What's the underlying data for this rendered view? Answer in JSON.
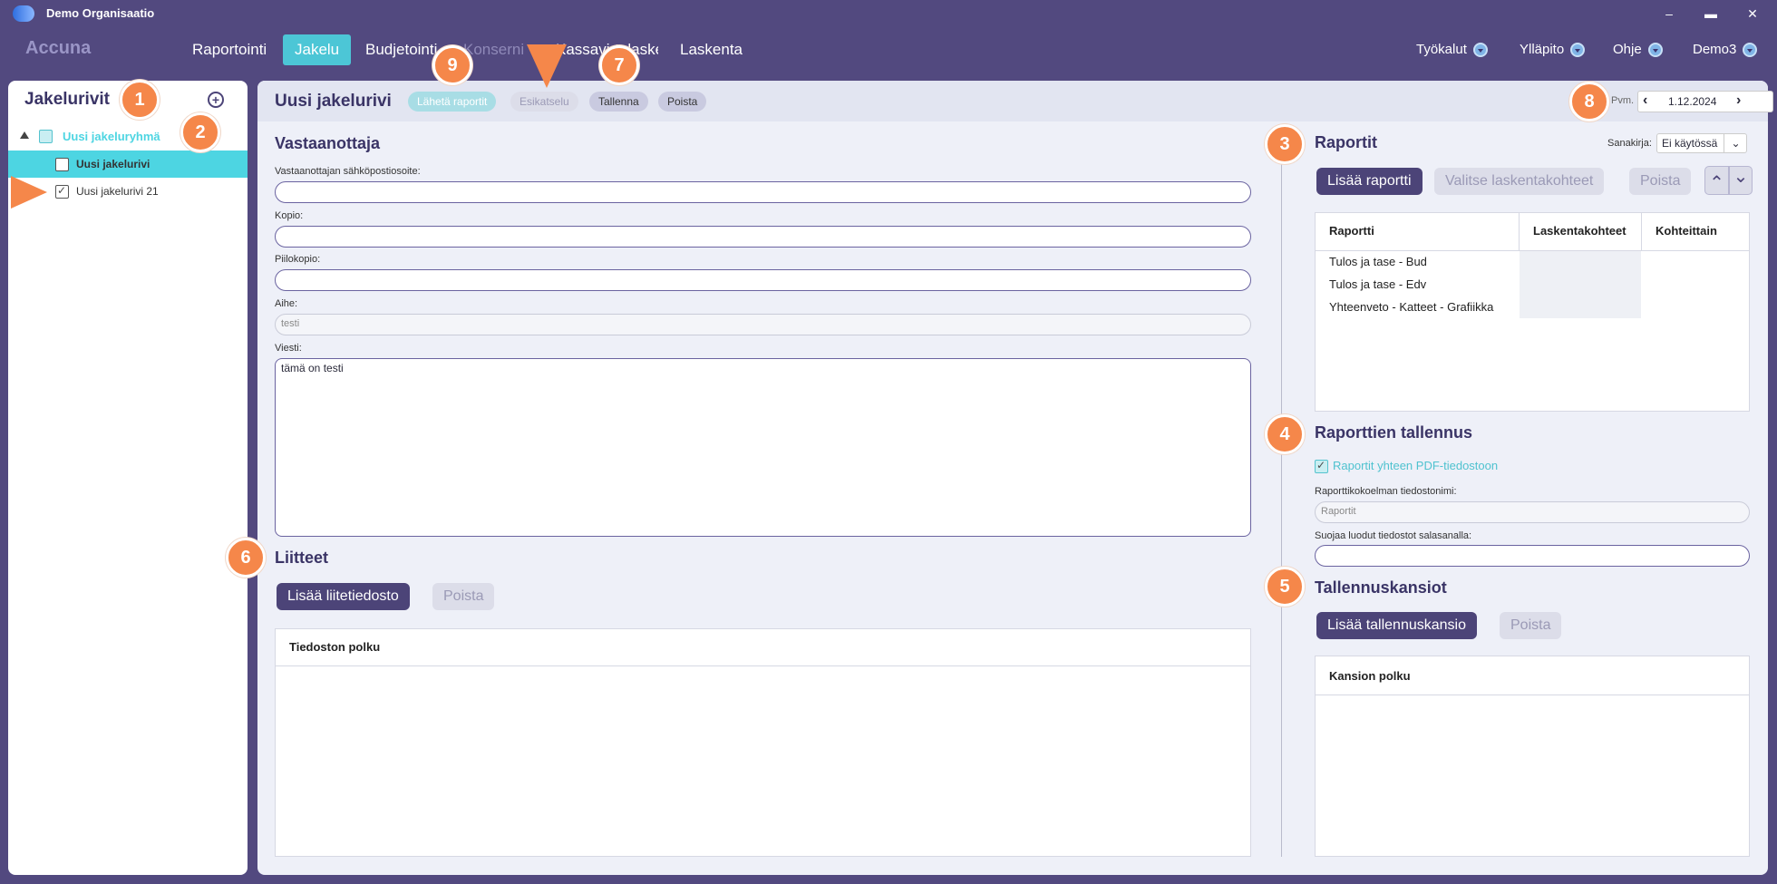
{
  "window": {
    "title": "Demo Organisaatio",
    "minimize": "–",
    "maximize": "▬",
    "close": "✕"
  },
  "nav": {
    "brand": "Accuna",
    "items": [
      "Raportointi",
      "Jakelu",
      "Budjetointi",
      "Konserni",
      "Kassavirtalaskenta",
      "Laskenta"
    ],
    "right": [
      "Työkalut",
      "Ylläpito",
      "Ohje",
      "Demo3"
    ]
  },
  "left": {
    "title": "Jakelurivit",
    "add": "⊕",
    "tree": [
      {
        "label": "Uusi jakeluryhmä",
        "level": 0
      },
      {
        "label": "Uusi jakelurivi",
        "level": 1,
        "selected": true
      },
      {
        "label": "Uusi jakelurivi 21",
        "level": 1,
        "checked": true
      }
    ]
  },
  "main": {
    "title": "Uusi jakelurivi",
    "actions": [
      "Lähetä raportit",
      "Esikatselu",
      "Tallenna",
      "Poista"
    ],
    "date_label": "Pvm.",
    "date_value": "1.12.2024",
    "prev": "‹",
    "next": "›"
  },
  "recipient": {
    "heading": "Vastaanottaja",
    "email_label": "Vastaanottajan sähköpostiosoite:",
    "email_value": "",
    "cc_label": "Kopio:",
    "bcc_label": "Piilokopio:",
    "subject_label": "Aihe:",
    "subject_value": "testi",
    "message_label": "Viesti:",
    "message_value": "tämä on testi"
  },
  "attachments": {
    "heading": "Liitteet",
    "add": "Lisää liitetiedosto",
    "delete": "Poista",
    "col": "Tiedoston polku"
  },
  "reports": {
    "heading": "Raportit",
    "dict_label": "Sanakirja:",
    "dict_value": "Ei käytössä",
    "add": "Lisää raportti",
    "select": "Valitse laskentakohteet",
    "delete": "Poista",
    "up": "⌃",
    "down": "⌄",
    "cols": [
      "Raportti",
      "Laskentakohteet",
      "Kohteittain"
    ],
    "rows": [
      "Tulos ja tase - Bud",
      "Tulos ja tase - Edv",
      "Yhteenveto -  Katteet - Grafiikka"
    ]
  },
  "saving": {
    "heading": "Raporttien tallennus",
    "pdf_label": "Raportit yhteen PDF-tiedostoon",
    "filename_label": "Raporttikokoelman tiedostonimi:",
    "filename_placeholder": "Raportit",
    "password_label": "Suojaa luodut tiedostot salasanalla:"
  },
  "folders": {
    "heading": "Tallennuskansiot",
    "add": "Lisää tallennuskansio",
    "delete": "Poista",
    "col": "Kansion polku"
  },
  "badges": [
    "1",
    "2",
    "3",
    "4",
    "5",
    "6",
    "7",
    "8",
    "9"
  ]
}
